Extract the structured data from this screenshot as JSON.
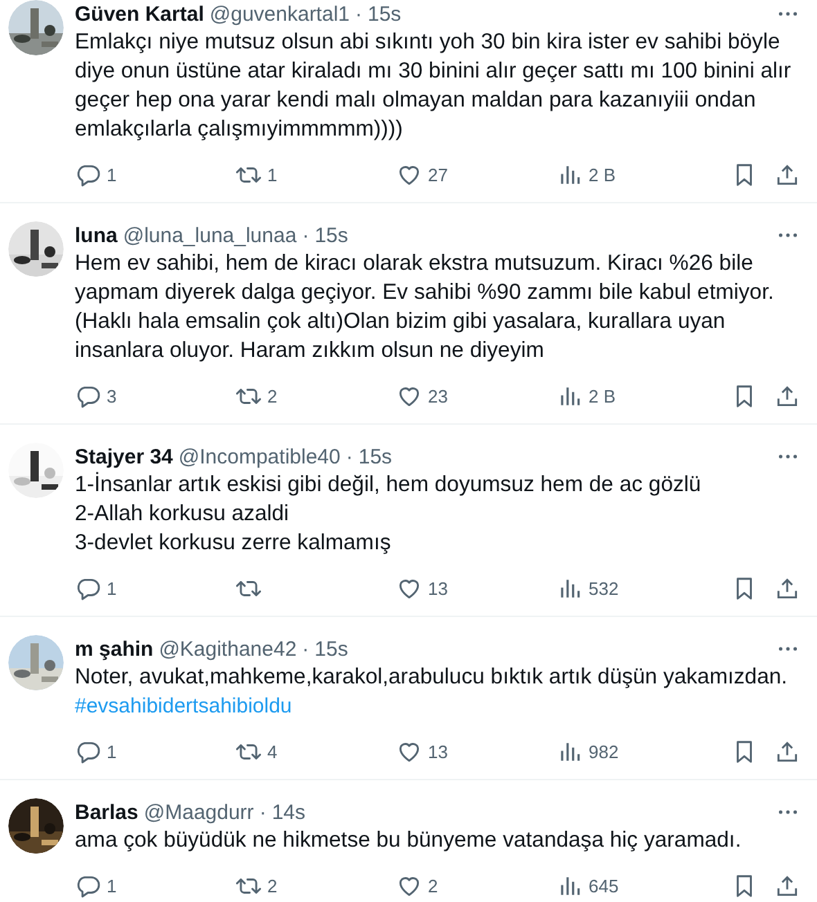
{
  "tweets": [
    {
      "name": "Güven Kartal",
      "handle": "@guvenkartal1",
      "separator": "·",
      "time": "15s",
      "text": "Emlakçı niye mutsuz olsun abi sıkıntı yoh 30 bin kira ister ev sahibi böyle diye onun üstüne atar kiraladı mı 30 binini alır geçer sattı mı 100 binini alır geçer hep ona yarar kendi malı olmayan maldan para kazanıyiii ondan emlakçılarla çalışmıyimmmmm))))",
      "replies": "1",
      "reposts": "1",
      "likes": "27",
      "views": "2 B"
    },
    {
      "name": "luna",
      "handle": "@luna_luna_lunaa",
      "separator": "·",
      "time": "15s",
      "text": "Hem ev sahibi, hem de kiracı olarak ekstra mutsuzum. Kiracı %26 bile yapmam diyerek dalga geçiyor. Ev sahibi %90 zammı bile kabul etmiyor. (Haklı hala emsalin çok altı)Olan bizim gibi yasalara, kurallara uyan insanlara oluyor. Haram zıkkım olsun ne diyeyim",
      "replies": "3",
      "reposts": "2",
      "likes": "23",
      "views": "2 B"
    },
    {
      "name": "Stajyer 34",
      "handle": "@Incompatible40",
      "separator": "·",
      "time": "15s",
      "text": "1-İnsanlar artık eskisi gibi değil, hem doyumsuz hem de ac gözlü\n2-Allah korkusu azaldi\n3-devlet korkusu zerre kalmamış",
      "replies": "1",
      "likes": "13",
      "views": "532"
    },
    {
      "name": "m şahin",
      "handle": "@Kagithane42",
      "separator": "·",
      "time": "15s",
      "text": "Noter, avukat,mahkeme,karakol,arabulucu bıktık artık düşün yakamızdan.",
      "hashtag": "#evsahibidertsahibioldu",
      "replies": "1",
      "reposts": "4",
      "likes": "13",
      "views": "982"
    },
    {
      "name": "Barlas",
      "handle": "@Maagdurr",
      "separator": "·",
      "time": "14s",
      "text": "ama çok büyüdük ne hikmetse bu bünyeme vatandaşa hiç yaramadı.",
      "replies": "1",
      "reposts": "2",
      "likes": "2",
      "views": "645"
    }
  ]
}
